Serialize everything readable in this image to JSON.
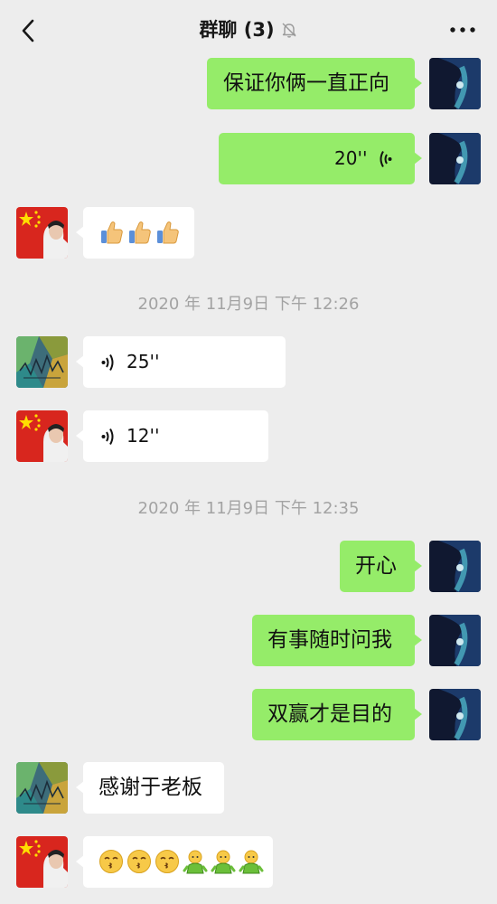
{
  "header": {
    "title": "群聊 (3)"
  },
  "timestamps": [
    "2020 年 11月9日 下午 12:26",
    "2020 年 11月9日 下午 12:35"
  ],
  "messages": {
    "m1": {
      "text": "保证你俩一直正向"
    },
    "m2": {
      "duration": "20''"
    },
    "m5": {
      "duration": "25''"
    },
    "m6": {
      "duration": "12''"
    },
    "m7": {
      "text": "开心"
    },
    "m8": {
      "text": "有事随时问我"
    },
    "m9": {
      "text": "双赢才是目的"
    },
    "m10": {
      "text": "感谢于老板"
    }
  },
  "colors": {
    "background": "#ededed",
    "bubble_sent": "#95ec69",
    "bubble_received": "#ffffff"
  }
}
